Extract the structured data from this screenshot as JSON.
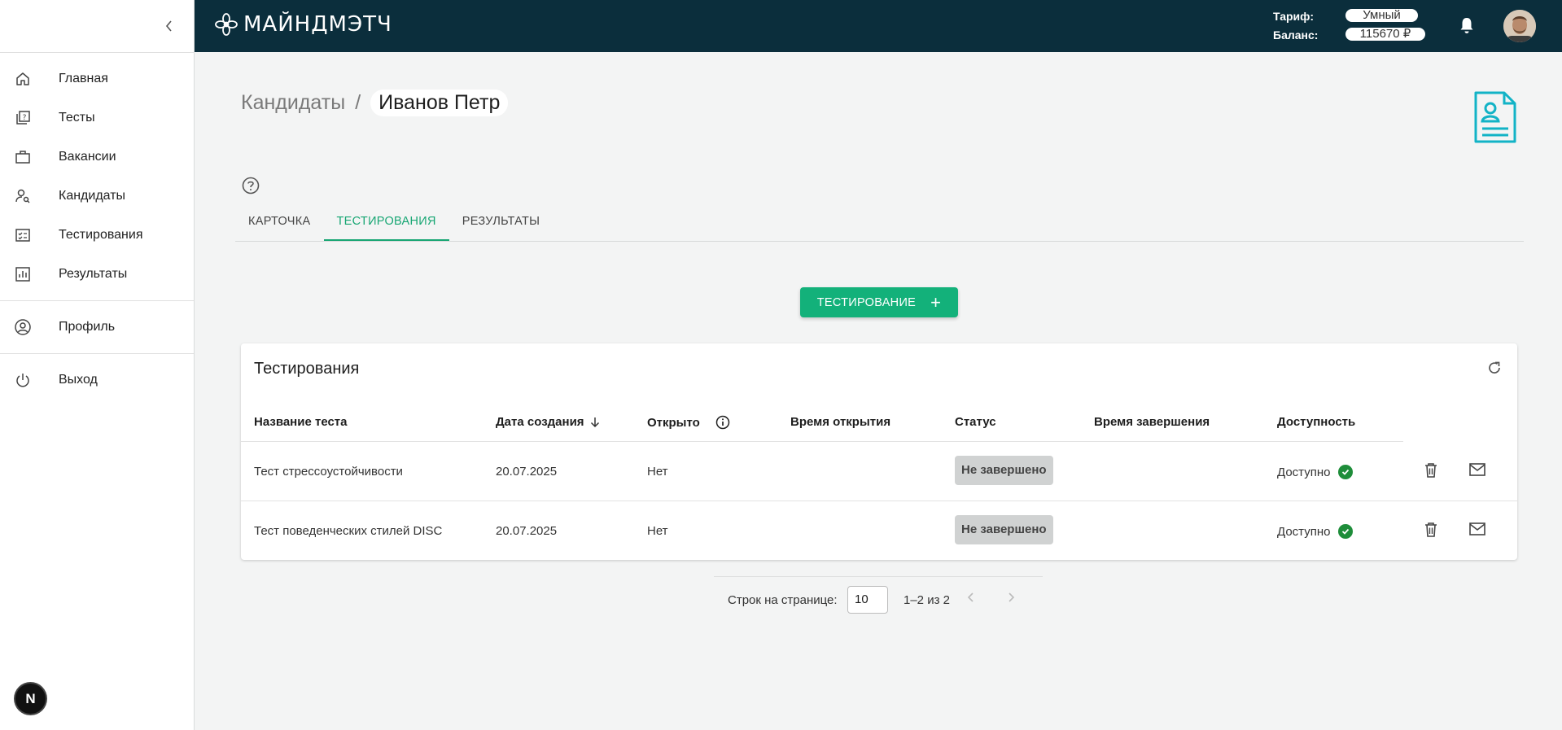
{
  "sidebar": {
    "items": [
      {
        "label": "Главная",
        "icon": "home-icon"
      },
      {
        "label": "Тесты",
        "icon": "quiz-icon"
      },
      {
        "label": "Вакансии",
        "icon": "briefcase-icon"
      },
      {
        "label": "Кандидаты",
        "icon": "person-search-icon"
      },
      {
        "label": "Тестирования",
        "icon": "checklist-icon"
      },
      {
        "label": "Результаты",
        "icon": "chart-icon"
      }
    ],
    "profile_label": "Профиль",
    "logout_label": "Выход",
    "badge_letter": "N"
  },
  "header": {
    "brand": "МАЙНДМЭТЧ",
    "tariff_label": "Тариф:",
    "tariff_value": "Умный",
    "balance_label": "Баланс:",
    "balance_value": "115670 ₽",
    "bg_color": "#0b2e3c"
  },
  "breadcrumb": {
    "root": "Кандидаты",
    "separator": "/",
    "current": "Иванов Петр"
  },
  "tabs": [
    {
      "label": "КАРТОЧКА",
      "active": false
    },
    {
      "label": "ТЕСТИРОВАНИЯ",
      "active": true
    },
    {
      "label": "РЕЗУЛЬТАТЫ",
      "active": false
    }
  ],
  "add_button": {
    "label": "ТЕСТИРОВАНИЕ",
    "color": "#13b17a"
  },
  "table": {
    "title": "Тестирования",
    "columns": [
      "Название теста",
      "Дата создания",
      "Открыто",
      "Время открытия",
      "Статус",
      "Время завершения",
      "Доступность"
    ],
    "rows": [
      {
        "name": "Тест стрессоустойчивости",
        "date": "20.07.2025",
        "opened": "Нет",
        "open_time": "",
        "status": "Не завершено",
        "finish_time": "",
        "availability": "Доступно"
      },
      {
        "name": "Тест поведенческих стилей DISC",
        "date": "20.07.2025",
        "opened": "Нет",
        "open_time": "",
        "status": "Не завершено",
        "finish_time": "",
        "availability": "Доступно"
      }
    ]
  },
  "pagination": {
    "rows_label": "Строк на странице:",
    "rows_value": "10",
    "range": "1–2 из 2"
  }
}
